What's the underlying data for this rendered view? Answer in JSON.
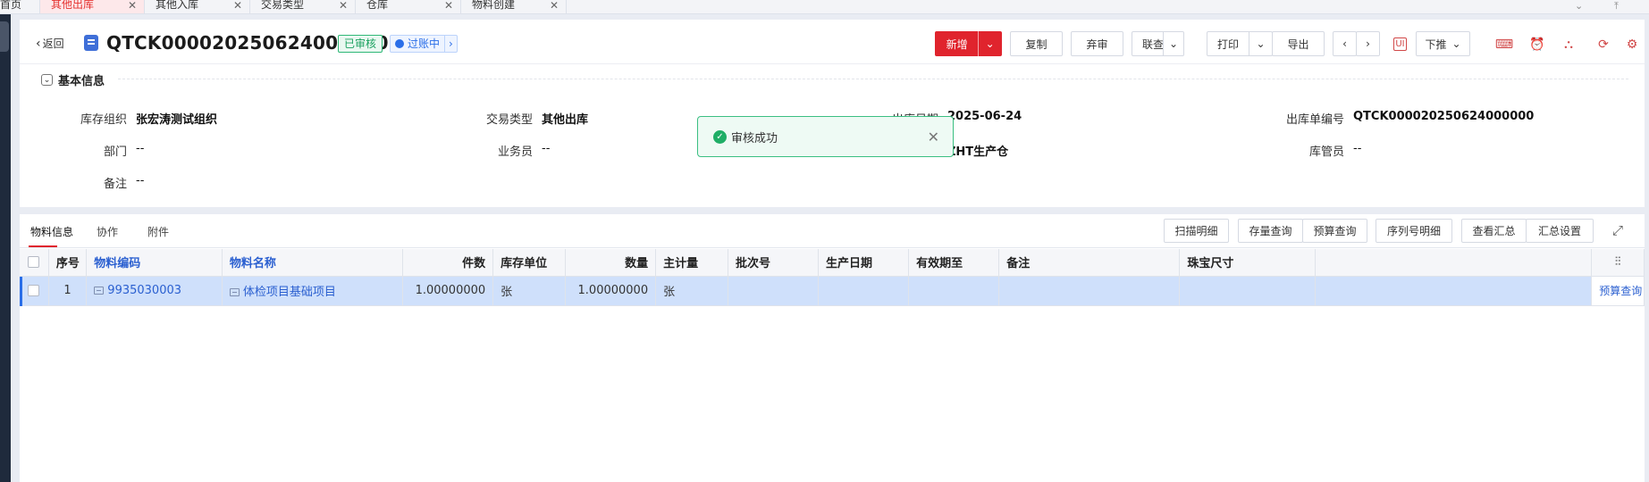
{
  "tabs": [
    {
      "label": "首页",
      "closable": false,
      "active": false
    },
    {
      "label": "其他出库",
      "closable": true,
      "active": true
    },
    {
      "label": "其他入库",
      "closable": true,
      "active": false
    },
    {
      "label": "交易类型",
      "closable": true,
      "active": false
    },
    {
      "label": "仓库",
      "closable": true,
      "active": false
    },
    {
      "label": "物料创建",
      "closable": true,
      "active": false
    }
  ],
  "header": {
    "back_label": "返回",
    "doc_number": "QTCK000020250624000000",
    "status_badge": "已审核",
    "process_badge": "过账中",
    "toolbar": {
      "new": "新增",
      "copy": "复制",
      "abandon_review": "弃审",
      "linked_query": "联查",
      "print": "打印",
      "export": "导出",
      "push_down": "下推"
    },
    "icons": [
      "prev-icon",
      "next-icon",
      "ui-icon",
      "keyboard-icon",
      "alarm-icon",
      "share-icon",
      "refresh-icon",
      "settings-icon"
    ]
  },
  "basic_info": {
    "section_title": "基本信息",
    "fields": {
      "inventory_org_label": "库存组织",
      "inventory_org_value": "张宏涛测试组织",
      "trade_type_label": "交易类型",
      "trade_type_value": "其他出库",
      "out_date_label": "出库日期",
      "out_date_value": "2025-06-24",
      "out_no_label": "出库单编号",
      "out_no_value": "QTCK000020250624000000",
      "dept_label": "部门",
      "dept_value": "--",
      "salesman_label": "业务员",
      "salesman_value": "--",
      "warehouse_value": "ZHT生产仓",
      "keeper_label": "库管员",
      "keeper_value": "--",
      "remark_label": "备注",
      "remark_value": "--"
    }
  },
  "toast": {
    "message": "审核成功"
  },
  "detail": {
    "tabs": [
      "物料信息",
      "协作",
      "附件"
    ],
    "buttons": {
      "scan_detail": "扫描明细",
      "stock_query": "存量查询",
      "budget_query": "预算查询",
      "serial_detail": "序列号明细",
      "view_summary": "查看汇总",
      "summary_settings": "汇总设置"
    },
    "columns": [
      "序号",
      "物料编码",
      "物料名称",
      "件数",
      "库存单位",
      "数量",
      "主计量",
      "批次号",
      "生产日期",
      "有效期至",
      "备注",
      "珠宝尺寸"
    ],
    "rows": [
      {
        "seq": "1",
        "material_code": "9935030003",
        "material_name": "体检项目基础项目",
        "pieces": "1.00000000",
        "stock_unit": "张",
        "quantity": "1.00000000",
        "main_unit": "张",
        "batch_no": "",
        "production_date": "",
        "expiry_date": "",
        "remark": "",
        "jewelry_size": "",
        "action": "预算查询"
      }
    ]
  }
}
